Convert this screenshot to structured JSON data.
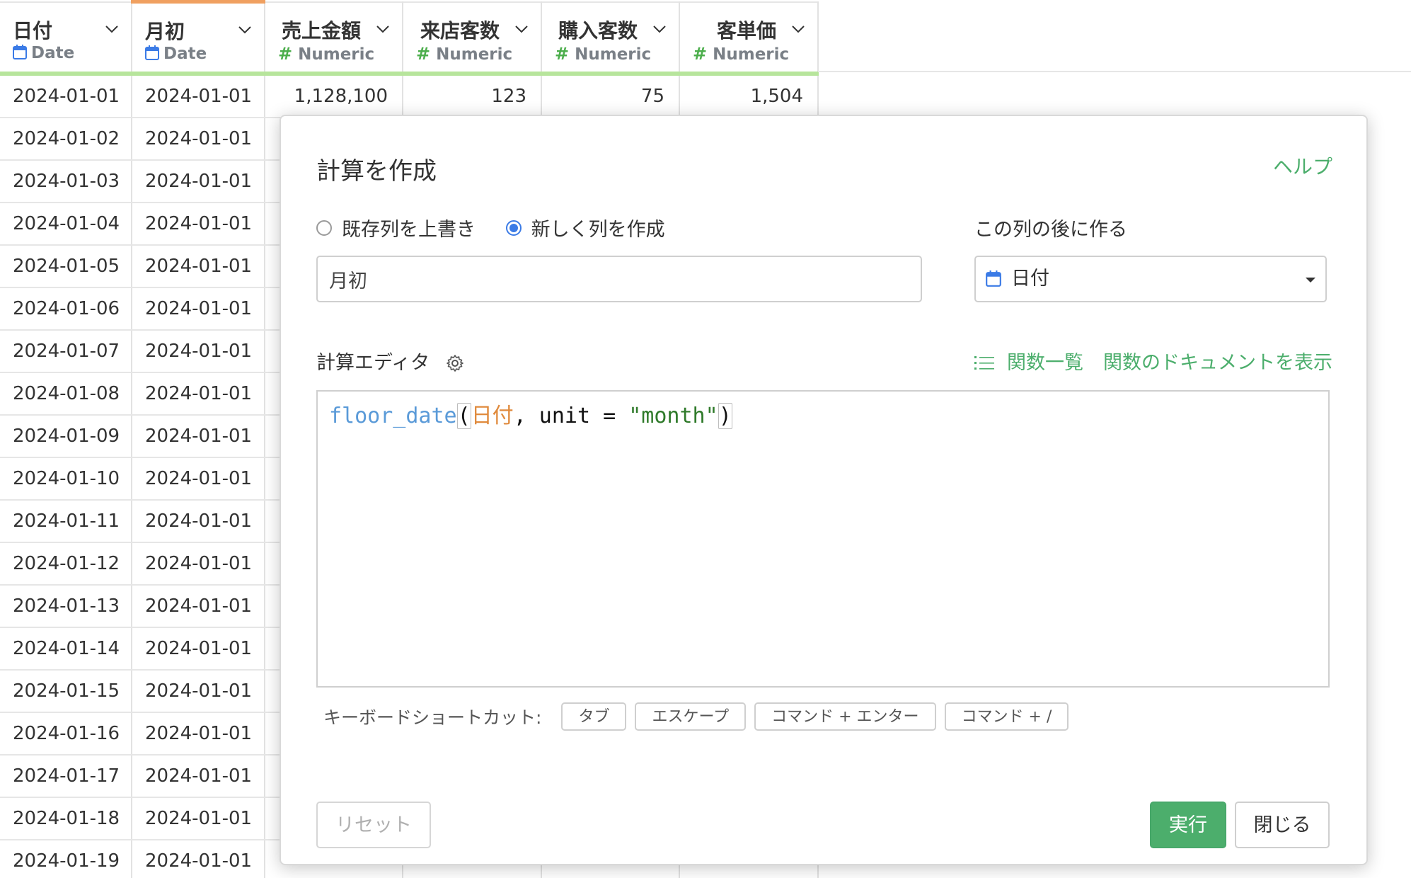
{
  "columns": [
    {
      "name": "日付",
      "type": "Date",
      "type_icon": "calendar-icon"
    },
    {
      "name": "月初",
      "type": "Date",
      "type_icon": "calendar-icon"
    },
    {
      "name": "売上金額",
      "type": "Numeric",
      "type_icon": "hash-icon"
    },
    {
      "name": "来店客数",
      "type": "Numeric",
      "type_icon": "hash-icon"
    },
    {
      "name": "購入客数",
      "type": "Numeric",
      "type_icon": "hash-icon"
    },
    {
      "name": "客単価",
      "type": "Numeric",
      "type_icon": "hash-icon"
    }
  ],
  "first_row": {
    "c1": "2024-01-01",
    "c2": "2024-01-01",
    "c3": "1,128,100",
    "c4": "123",
    "c5": "75",
    "c6": "1,504"
  },
  "rows": [
    {
      "c1": "2024-01-02",
      "c2": "2024-01-01"
    },
    {
      "c1": "2024-01-03",
      "c2": "2024-01-01"
    },
    {
      "c1": "2024-01-04",
      "c2": "2024-01-01"
    },
    {
      "c1": "2024-01-05",
      "c2": "2024-01-01"
    },
    {
      "c1": "2024-01-06",
      "c2": "2024-01-01"
    },
    {
      "c1": "2024-01-07",
      "c2": "2024-01-01"
    },
    {
      "c1": "2024-01-08",
      "c2": "2024-01-01"
    },
    {
      "c1": "2024-01-09",
      "c2": "2024-01-01"
    },
    {
      "c1": "2024-01-10",
      "c2": "2024-01-01"
    },
    {
      "c1": "2024-01-11",
      "c2": "2024-01-01"
    },
    {
      "c1": "2024-01-12",
      "c2": "2024-01-01"
    },
    {
      "c1": "2024-01-13",
      "c2": "2024-01-01"
    },
    {
      "c1": "2024-01-14",
      "c2": "2024-01-01"
    },
    {
      "c1": "2024-01-15",
      "c2": "2024-01-01"
    },
    {
      "c1": "2024-01-16",
      "c2": "2024-01-01"
    },
    {
      "c1": "2024-01-17",
      "c2": "2024-01-01"
    },
    {
      "c1": "2024-01-18",
      "c2": "2024-01-01"
    },
    {
      "c1": "2024-01-19",
      "c2": "2024-01-01"
    }
  ],
  "dialog": {
    "title": "計算を作成",
    "help": "ヘルプ",
    "radio_overwrite": "既存列を上書き",
    "radio_new": "新しく列を作成",
    "after_label": "この列の後に作る",
    "new_column_name": "月初",
    "after_column": "日付",
    "editor_label": "計算エディタ",
    "function_list": "関数一覧",
    "function_docs": "関数のドキュメントを表示",
    "code": {
      "fn": "floor_date",
      "open": "(",
      "col": "日付",
      "sep": ", unit = ",
      "str": "\"month\"",
      "close": ")"
    },
    "shortcuts_label": "キーボードショートカット:",
    "keys": [
      "タブ",
      "エスケープ",
      "コマンド + エンター",
      "コマンド + /"
    ],
    "reset": "リセット",
    "run": "実行",
    "close": "閉じる"
  },
  "colors": {
    "accent_green": "#4cae6c",
    "header_underline": "#b7e59c",
    "active_column_top": "#f0a060",
    "radio_selected": "#3b7be6",
    "function_token": "#5a9ad8",
    "column_token": "#e08a3c",
    "string_token": "#2f7a2a"
  }
}
